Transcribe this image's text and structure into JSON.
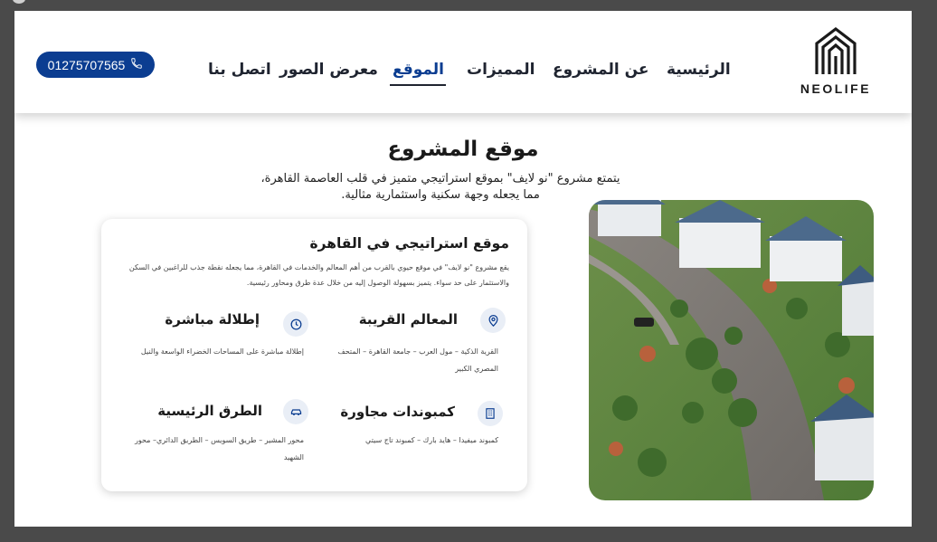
{
  "brand": {
    "logo_text": "NEOLIFE"
  },
  "nav": {
    "home": "الرئيسية",
    "about": "عن المشروع",
    "features": "المميزات",
    "location": "الموقع",
    "gallery": "معرض الصور",
    "contact": "اتصل بنا",
    "active": "location"
  },
  "phone": {
    "number": "01275707565",
    "icon": "phone-icon"
  },
  "section": {
    "title": "موقع المشروع",
    "desc_line1": "يتمتع مشروع \"نو لايف\" بموقع استراتيجي متميز في قلب العاصمة القاهرة،",
    "desc_line2": "مما يجعله وجهة سكنية واستثمارية مثالية."
  },
  "card": {
    "title": "موقع استراتيجي في القاهرة",
    "desc": "يقع مشروع \"نو لايف\" في موقع حيوي بالقرب من أهم المعالم والخدمات في القاهرة، مما يجعله نقطة جذب للراغبين في السكن والاستثمار على حد سواء. يتميز بسهولة الوصول إليه من خلال عدة طرق ومحاور رئيسية.",
    "features": [
      {
        "title": "المعالم القريبة",
        "icon": "map-pin-icon",
        "text": "القرية الذكية – مول العرب – جامعة القاهرة – المتحف المصري الكبير"
      },
      {
        "title": "إطلالة مباشرة",
        "icon": "clock-icon",
        "text": "إطلالة مباشرة على المساحات الخضراء الواسعة والنيل"
      },
      {
        "title": "كمبوندات مجاورة",
        "icon": "building-icon",
        "text": "كمبوند ميفيدا – هايد بارك – كمبوند تاج سيتي"
      },
      {
        "title": "الطرق الرئيسية",
        "icon": "car-icon",
        "text": "محور المشير – طريق السويس – الطريق الدائري– محور الشهيد"
      }
    ]
  },
  "colors": {
    "accent": "#0b3d91",
    "background": "#4a4a4a",
    "page": "#ffffff"
  }
}
